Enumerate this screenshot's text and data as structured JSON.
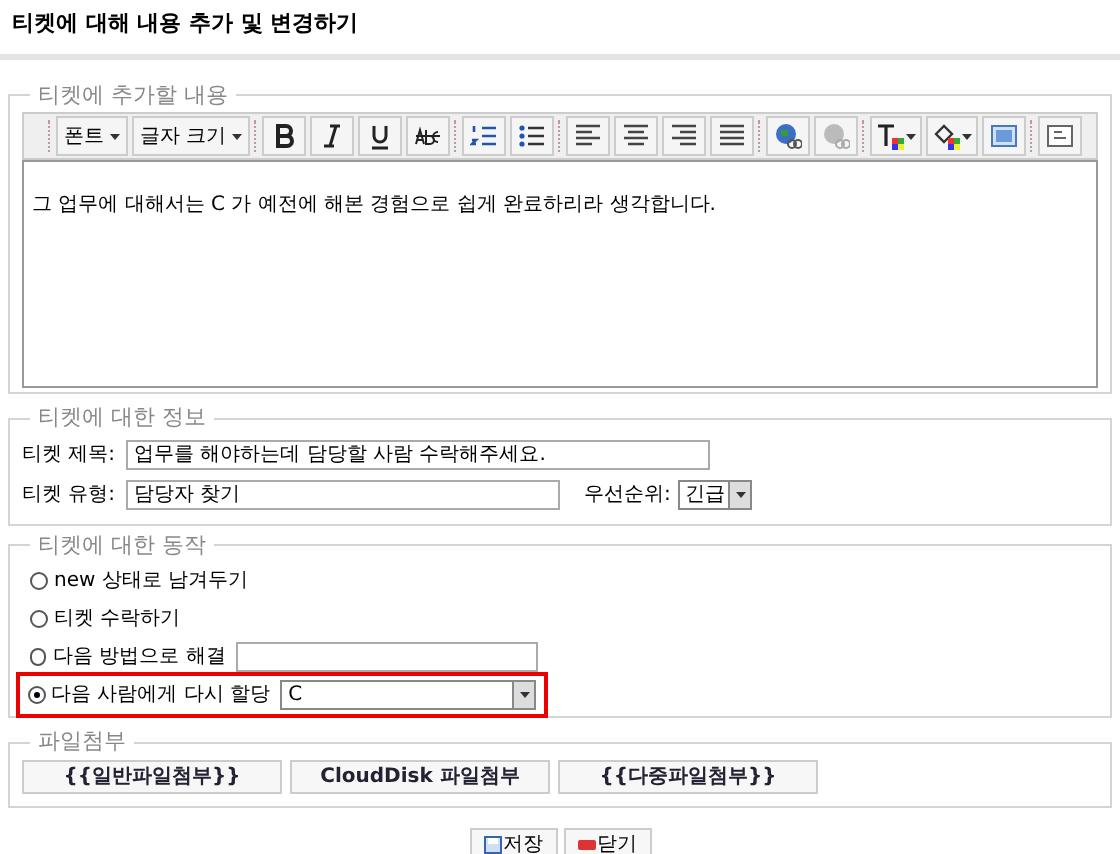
{
  "title": "티켓에 대해 내용 추가 및 변경하기",
  "content_section": {
    "legend": "티켓에 추가할 내용",
    "toolbar": [
      {
        "kind": "dropdown",
        "label": "폰트"
      },
      {
        "kind": "dropdown",
        "label": "글자 크기"
      },
      {
        "kind": "bold"
      },
      {
        "kind": "italic"
      },
      {
        "kind": "underline"
      },
      {
        "kind": "strike"
      },
      {
        "kind": "ordered-list"
      },
      {
        "kind": "bullet-list"
      },
      {
        "kind": "align-left"
      },
      {
        "kind": "align-center"
      },
      {
        "kind": "align-right"
      },
      {
        "kind": "justify"
      },
      {
        "kind": "link"
      },
      {
        "kind": "unlink"
      },
      {
        "kind": "text-color"
      },
      {
        "kind": "fill-color"
      },
      {
        "kind": "image"
      },
      {
        "kind": "source"
      }
    ],
    "body": "그 업무에 대해서는 C 가 예전에 해본 경험으로 쉽게 완료하리라 생각합니다."
  },
  "info_section": {
    "legend": "티켓에 대한 정보",
    "title_label": "티켓 제목:",
    "title_value": "업무를 해야하는데 담당할 사람 수락해주세요.",
    "type_label": "티켓 유형:",
    "type_value": "담당자 찾기",
    "priority_label": "우선순위:",
    "priority_value": "긴급"
  },
  "action_section": {
    "legend": "티켓에 대한 동작",
    "options": [
      {
        "label": "new 상태로 남겨두기",
        "kind": "plain",
        "selected": false
      },
      {
        "label": "티켓 수락하기",
        "kind": "plain",
        "selected": false
      },
      {
        "label": "다음 방법으로 해결",
        "kind": "text",
        "selected": false
      },
      {
        "label": "다음 사람에게 다시 할당",
        "kind": "select",
        "value": "C",
        "selected": true
      }
    ]
  },
  "attach_section": {
    "legend": "파일첨부",
    "buttons": [
      "{{일반파일첨부}}",
      "CloudDisk 파일첨부",
      "{{다중파일첨부}}"
    ]
  },
  "buttons": [
    {
      "kind": "save",
      "label": "저장"
    },
    {
      "kind": "close",
      "label": "닫기"
    }
  ]
}
